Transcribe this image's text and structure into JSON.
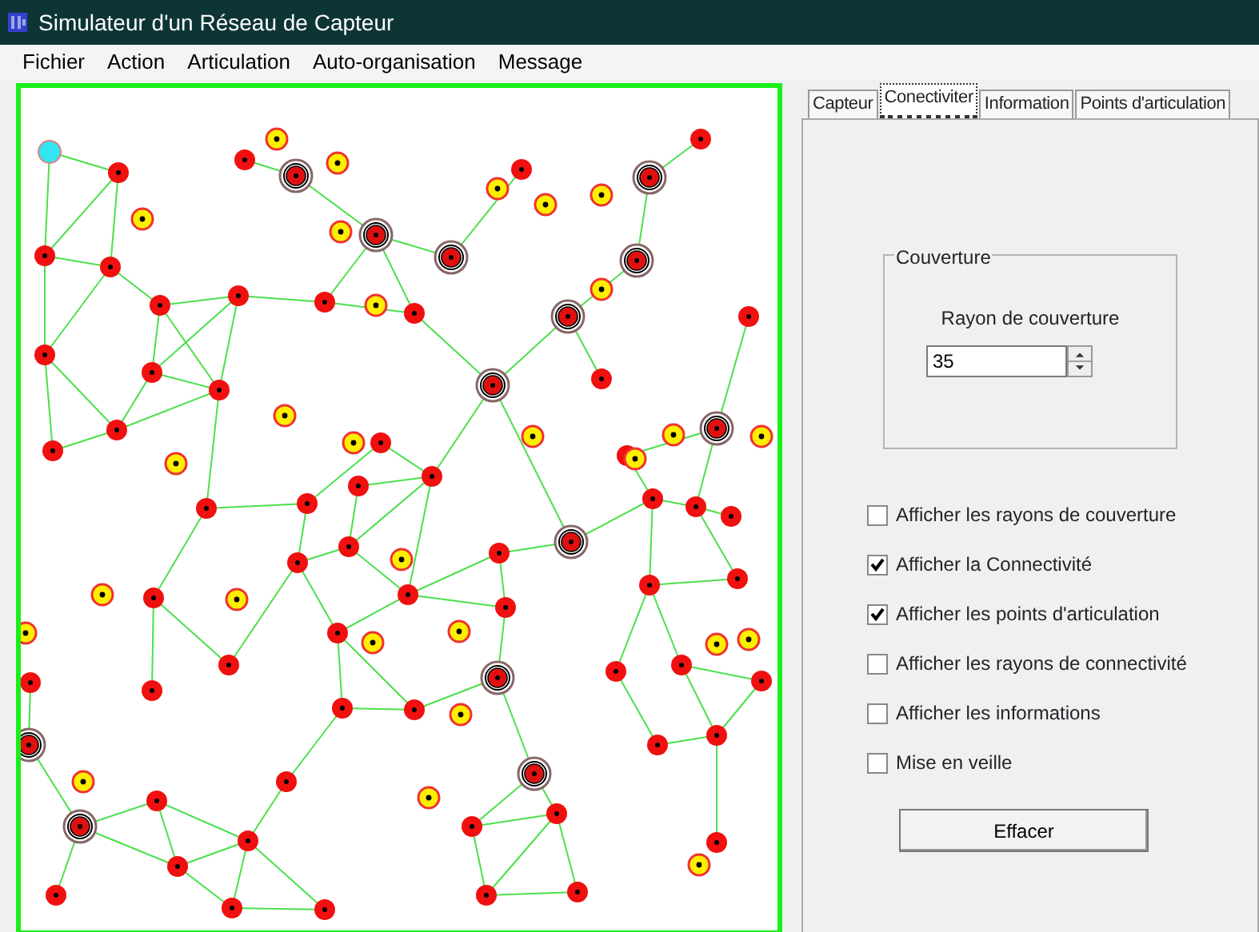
{
  "window": {
    "title": "Simulateur d'un Réseau de Capteur"
  },
  "menu": [
    {
      "label": "Fichier"
    },
    {
      "label": "Action"
    },
    {
      "label": "Articulation"
    },
    {
      "label": "Auto-organisation"
    },
    {
      "label": "Message"
    }
  ],
  "tabs": [
    {
      "label": "Capteur",
      "selected": false
    },
    {
      "label": "Conectiviter",
      "selected": true
    },
    {
      "label": "Information",
      "selected": false
    },
    {
      "label": "Points d'articulation",
      "selected": false
    }
  ],
  "coverage_group": {
    "title": "Couverture",
    "field_label": "Rayon de couverture",
    "value": "35"
  },
  "options": [
    {
      "label": "Afficher les rayons de couverture",
      "checked": false
    },
    {
      "label": "Afficher la Connectivité",
      "checked": true
    },
    {
      "label": "Afficher les points d'articulation",
      "checked": true
    },
    {
      "label": "Afficher les rayons de connectivité",
      "checked": false
    },
    {
      "label": "Afficher les informations",
      "checked": false
    },
    {
      "label": "Mise en veille",
      "checked": false
    }
  ],
  "buttons": [
    "Effacer"
  ]
}
